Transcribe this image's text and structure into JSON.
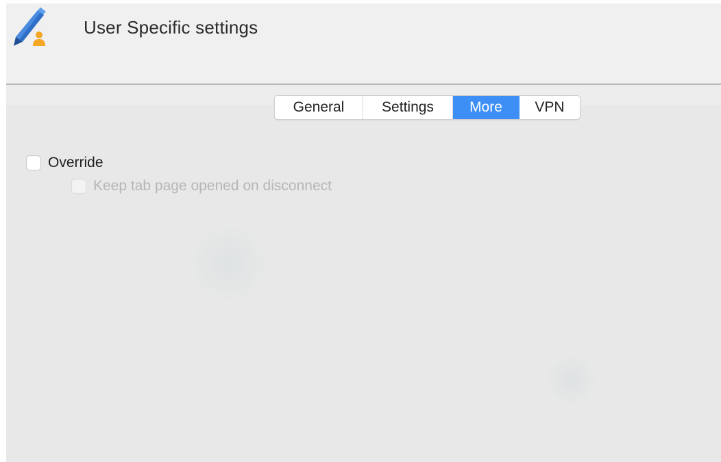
{
  "window": {
    "title": "User Specific settings",
    "app_icon": "pencil-user-icon"
  },
  "tabs": [
    {
      "label": "General",
      "active": false
    },
    {
      "label": "Settings",
      "active": false
    },
    {
      "label": "More",
      "active": true
    },
    {
      "label": "VPN",
      "active": false
    }
  ],
  "options": {
    "override": {
      "label": "Override",
      "checked": false,
      "enabled": true
    },
    "keep_tab_open": {
      "label": "Keep tab page opened on disconnect",
      "checked": false,
      "enabled": false
    }
  },
  "colors": {
    "accent": "#3d8ff6",
    "icon_blue": "#2f6fc7",
    "icon_orange": "#f5a623"
  }
}
